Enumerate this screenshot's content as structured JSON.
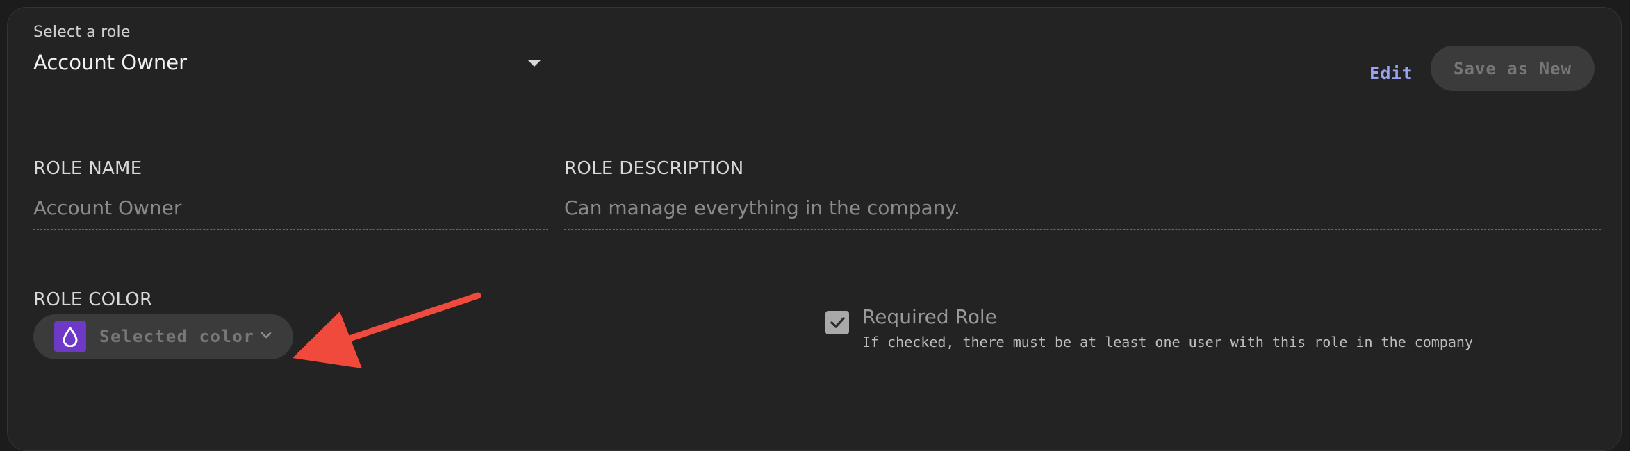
{
  "role_select": {
    "label": "Select a role",
    "value": "Account Owner"
  },
  "header": {
    "edit_label": "Edit",
    "save_as_new_label": "Save as New"
  },
  "fields": {
    "role_name": {
      "label": "ROLE NAME",
      "value": "Account Owner"
    },
    "role_description": {
      "label": "ROLE DESCRIPTION",
      "value": "Can manage everything in the company."
    },
    "role_color": {
      "label": "ROLE COLOR",
      "button_label": "Selected color",
      "swatch_color": "#6f39c8",
      "swatch_icon": "droplet-icon"
    }
  },
  "required_role": {
    "title": "Required Role",
    "help_text": "If checked, there must be at least one user with this role in the company",
    "checked": true
  },
  "colors": {
    "accent_link": "#9aa2f2",
    "annotation_arrow": "#f04a3c"
  }
}
